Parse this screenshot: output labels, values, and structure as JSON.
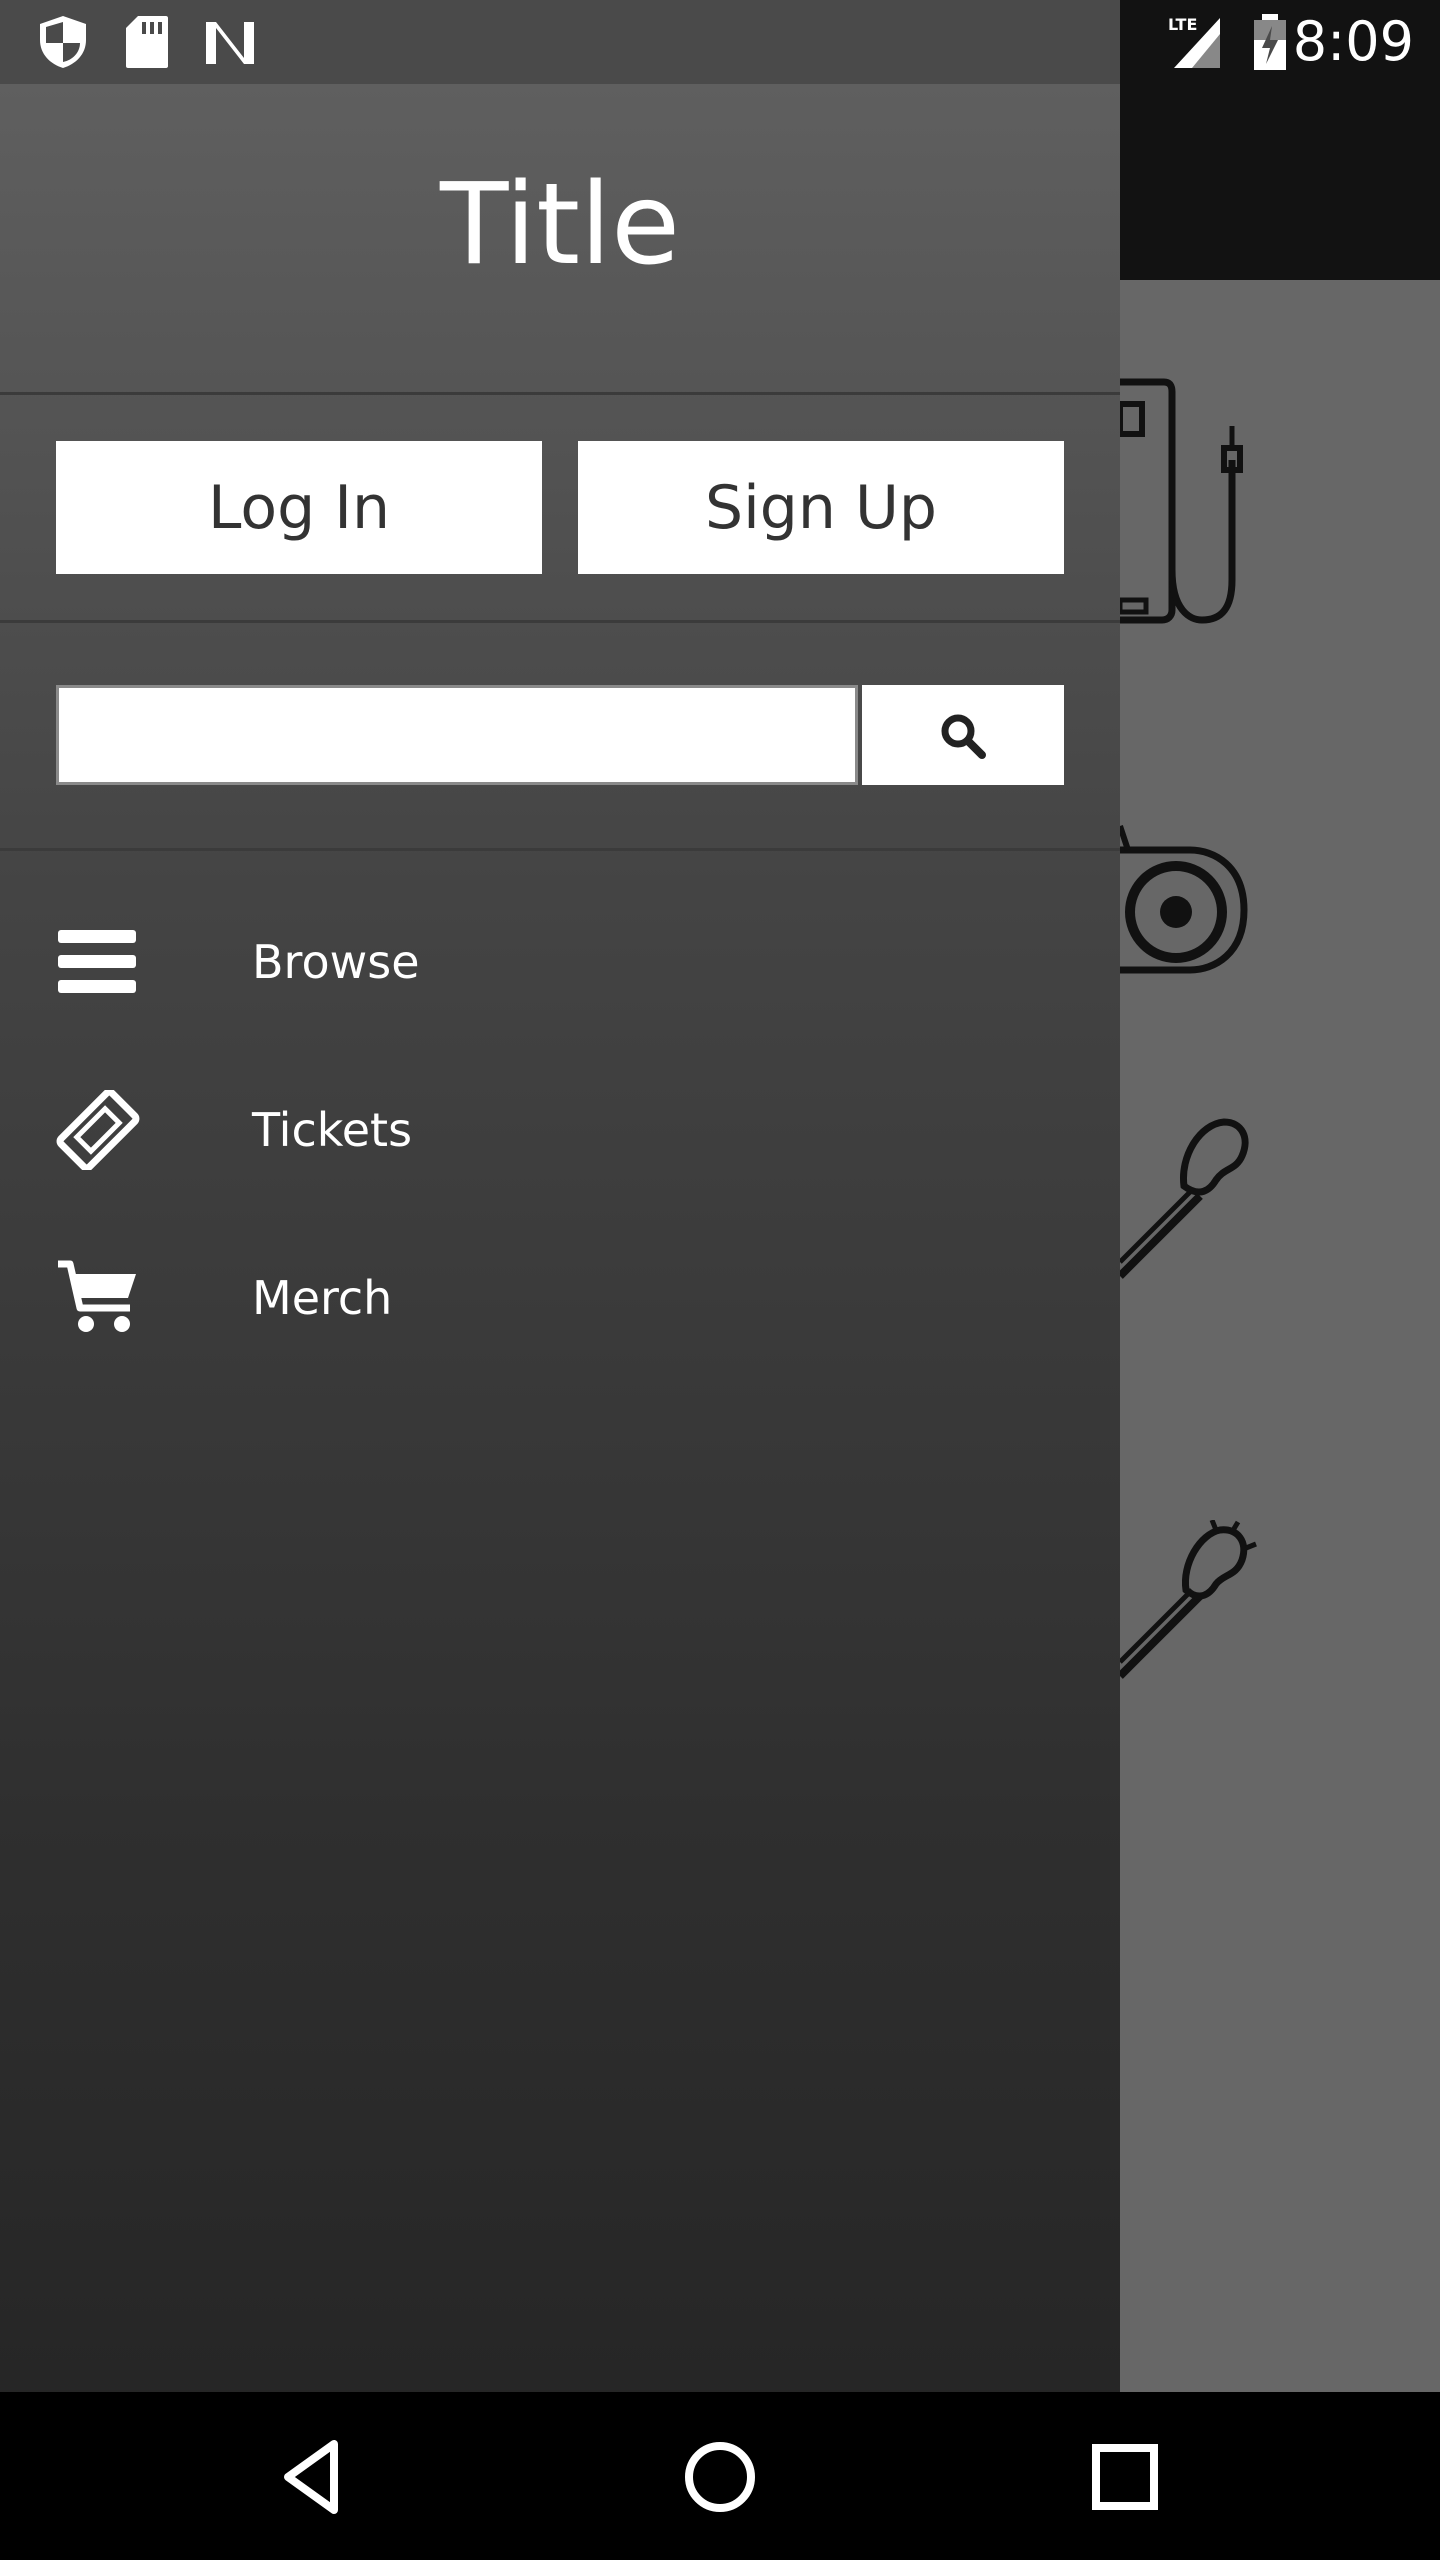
{
  "status_bar": {
    "time": "8:09",
    "network": "LTE",
    "left_icons": [
      "shield-icon",
      "sd-card-icon",
      "n-logo-icon"
    ],
    "right_icons": [
      "signal-icon",
      "battery-charging-icon"
    ]
  },
  "drawer": {
    "title": "Title",
    "login_label": "Log In",
    "signup_label": "Sign Up",
    "search": {
      "value": "",
      "placeholder": "",
      "icon": "search-icon",
      "caret_color": "#e91e63"
    },
    "nav_items": [
      {
        "label": "Browse",
        "icon": "menu-icon"
      },
      {
        "label": "Tickets",
        "icon": "ticket-icon"
      },
      {
        "label": "Merch",
        "icon": "cart-icon"
      }
    ]
  },
  "background_app": {
    "art": [
      "amplifier-icon",
      "speaker-icon",
      "guitar-icon",
      "guitar-icon"
    ]
  },
  "nav_bar": {
    "buttons": [
      "back-icon",
      "home-icon",
      "recents-icon"
    ]
  }
}
